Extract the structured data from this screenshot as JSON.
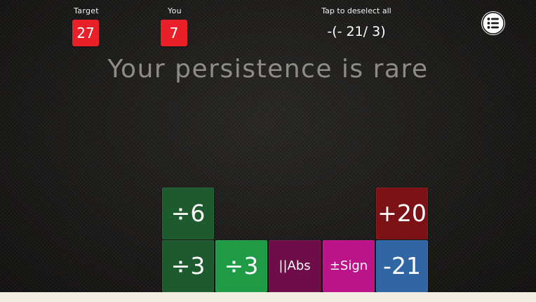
{
  "header": {
    "target_label": "Target",
    "target_value": "27",
    "you_label": "You",
    "you_value": "7",
    "hint": "Tap to deselect all",
    "expression": "-(- 21/ 3)"
  },
  "message": "Your persistence is rare",
  "menu": {
    "icon": "list-menu-icon"
  },
  "tiles": [
    {
      "label": "÷6",
      "column": 1,
      "row": 2,
      "color": "#1d5b2f"
    },
    {
      "label": "÷3",
      "column": 1,
      "row": 1,
      "color": "#1d5b2f"
    },
    {
      "label": "÷3",
      "column": 2,
      "row": 1,
      "color": "#1f9b46"
    },
    {
      "label": "||Abs",
      "column": 3,
      "row": 1,
      "color": "#6f0d4b"
    },
    {
      "label": "±Sign",
      "column": 4,
      "row": 1,
      "color": "#ba1488"
    },
    {
      "label": "+20",
      "column": 5,
      "row": 2,
      "color": "#7c1215"
    },
    {
      "label": "-21",
      "column": 5,
      "row": 1,
      "color": "#2f66a3"
    }
  ],
  "colors": {
    "score_box": "#e8202a",
    "floor": "#f3ece0",
    "message_text": "#8d8c89"
  }
}
